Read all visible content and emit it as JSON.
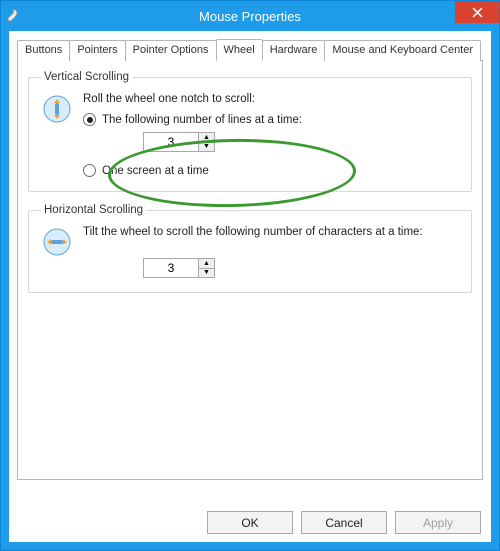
{
  "window": {
    "title": "Mouse Properties"
  },
  "tabs": {
    "items": [
      {
        "label": "Buttons"
      },
      {
        "label": "Pointers"
      },
      {
        "label": "Pointer Options"
      },
      {
        "label": "Wheel"
      },
      {
        "label": "Hardware"
      },
      {
        "label": "Mouse and Keyboard Center"
      }
    ],
    "active_index": 3
  },
  "vertical": {
    "legend": "Vertical Scrolling",
    "instruction": "Roll the wheel one notch to scroll:",
    "option_lines": "The following number of lines at a time:",
    "option_screen": "One screen at a time",
    "selected": "lines",
    "lines_value": "3"
  },
  "horizontal": {
    "legend": "Horizontal Scrolling",
    "instruction": "Tilt the wheel to scroll the following number of characters at a time:",
    "chars_value": "3"
  },
  "buttons": {
    "ok": "OK",
    "cancel": "Cancel",
    "apply": "Apply"
  },
  "colors": {
    "accent": "#1e9be9",
    "highlight": "#3a9a2e",
    "close": "#d9432f"
  }
}
